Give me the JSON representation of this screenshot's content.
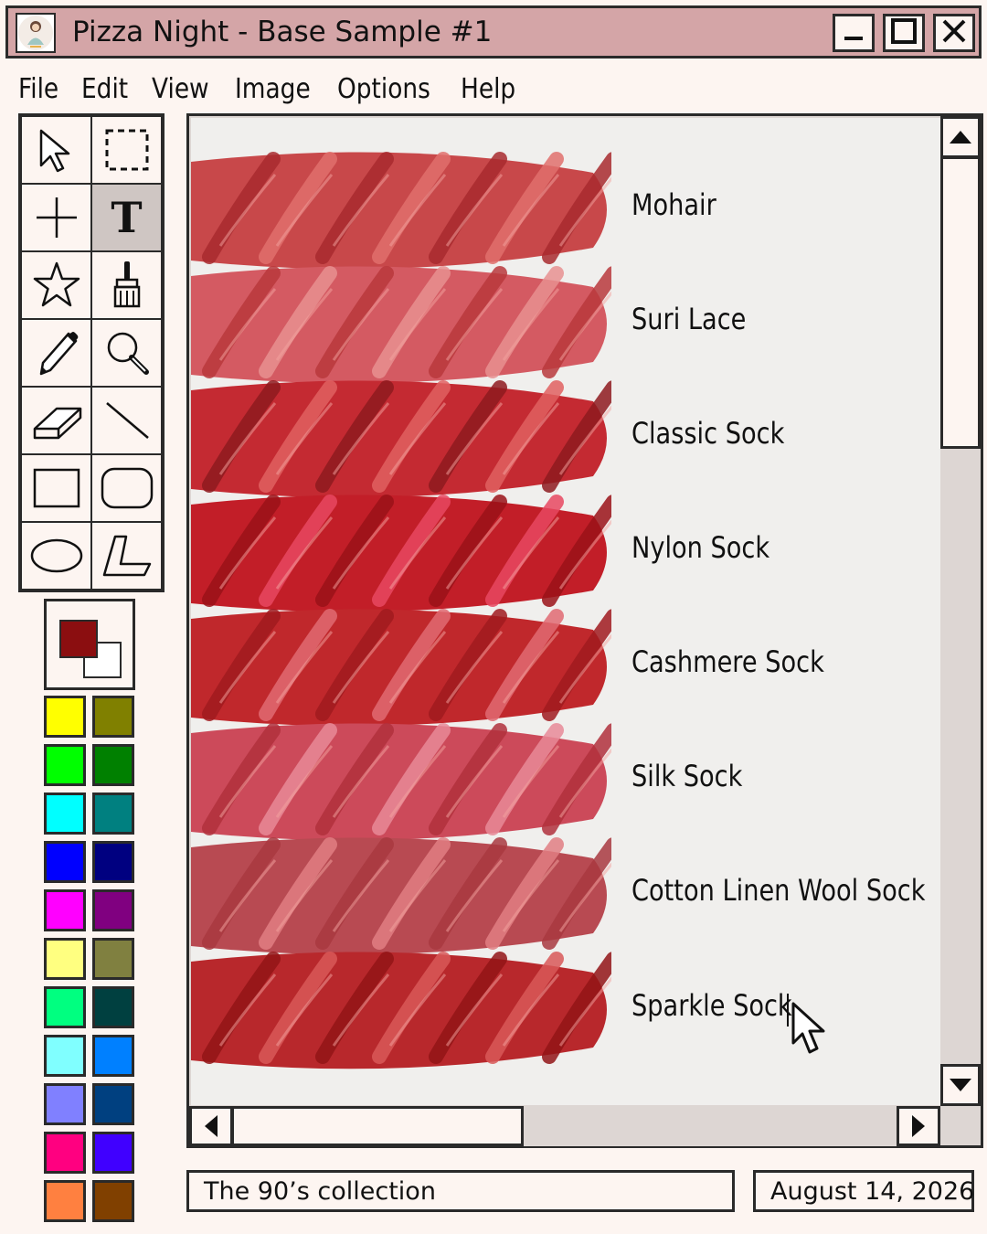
{
  "window": {
    "title": "Pizza Night - Base Sample #1",
    "controls": [
      "minimize-icon",
      "maximize-icon",
      "close-icon"
    ]
  },
  "menu": [
    "File",
    "Edit",
    "View",
    "Image",
    "Options",
    "Help"
  ],
  "tools": [
    {
      "name": "select-arrow-icon"
    },
    {
      "name": "rect-select-icon"
    },
    {
      "name": "crosshair-icon"
    },
    {
      "name": "text-tool-icon",
      "glyph": "T",
      "active": true
    },
    {
      "name": "star-icon"
    },
    {
      "name": "brush-icon"
    },
    {
      "name": "pencil-icon"
    },
    {
      "name": "magnifier-icon"
    },
    {
      "name": "eraser-icon"
    },
    {
      "name": "line-icon"
    },
    {
      "name": "rectangle-icon"
    },
    {
      "name": "rounded-rectangle-icon"
    },
    {
      "name": "ellipse-icon"
    },
    {
      "name": "polygon-icon"
    }
  ],
  "colors": {
    "foreground": "#8b0e10",
    "background": "#ffffff",
    "palette": [
      [
        "#ffff00",
        "#808000"
      ],
      [
        "#00ff00",
        "#008000"
      ],
      [
        "#00ffff",
        "#008080"
      ],
      [
        "#0000ff",
        "#000080"
      ],
      [
        "#ff00ff",
        "#800080"
      ],
      [
        "#ffff80",
        "#808040"
      ],
      [
        "#00ff80",
        "#004040"
      ],
      [
        "#80ffff",
        "#0080ff"
      ],
      [
        "#8080ff",
        "#004080"
      ],
      [
        "#ff0080",
        "#4000ff"
      ],
      [
        "#ff8040",
        "#804000"
      ]
    ]
  },
  "canvas": {
    "yarn_bases": [
      {
        "label": "Mohair",
        "colors": [
          "#c8484a",
          "#e0706c",
          "#a82a2e"
        ]
      },
      {
        "label": "Suri Lace",
        "colors": [
          "#d45a62",
          "#e89090",
          "#b8383c"
        ]
      },
      {
        "label": "Classic Sock",
        "colors": [
          "#c42a32",
          "#e06060",
          "#8e1a1e"
        ]
      },
      {
        "label": "Nylon Sock",
        "colors": [
          "#c21e28",
          "#e84860",
          "#9a1218"
        ]
      },
      {
        "label": "Cashmere Sock",
        "colors": [
          "#c0282c",
          "#e06a72",
          "#a01a1e"
        ]
      },
      {
        "label": "Silk Sock",
        "colors": [
          "#cc4a5a",
          "#e88a98",
          "#b0303c"
        ]
      },
      {
        "label": "Cotton Linen Wool Sock",
        "colors": [
          "#b84a52",
          "#e07e82",
          "#a83840"
        ]
      },
      {
        "label": "Sparkle Sock",
        "colors": [
          "#b8282c",
          "#d85858",
          "#921416"
        ]
      }
    ]
  },
  "status": {
    "left": "The 90’s collection",
    "right": "August 14, 2026"
  }
}
